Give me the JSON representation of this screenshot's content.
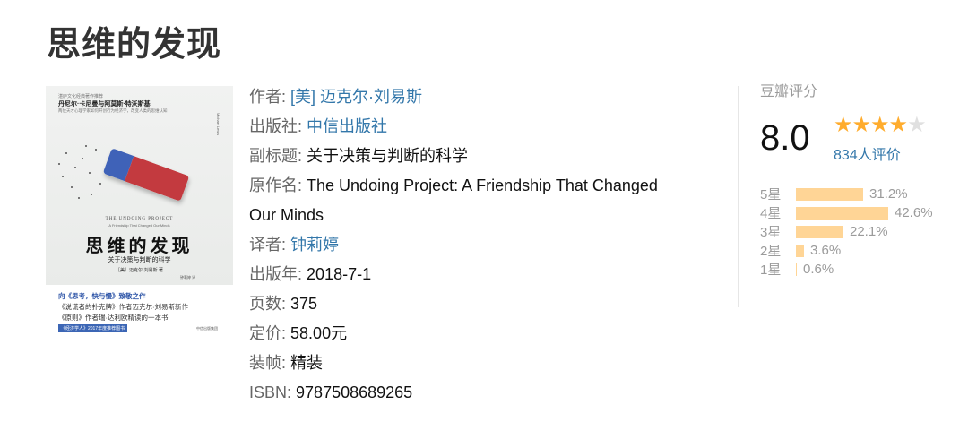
{
  "page": {
    "title": "思维的发现"
  },
  "cover": {
    "series": "湛庐文化经典著作推荐",
    "authors": "丹尼尔·卡尼曼与阿莫斯·特沃斯基",
    "blurb": "两位天才心理学家如何开创行为经济学，改变人类的思维认知",
    "side_text": "Michael Lewis",
    "en_title": "THE UNDOING PROJECT",
    "en_subtitle": "A Friendship That Changed Our Minds",
    "cn_title": "思维的发现",
    "cn_subtitle": "关于决策与判断的科学",
    "cn_author": "［美］迈克尔·刘易斯 著",
    "translator": "钟莉婷 译",
    "promo_1": "向《思考，快与慢》致敬之作",
    "promo_2": "《说谎者的扑克牌》作者迈克尔·刘易斯新作",
    "promo_3": "《原则》作者瑞·达利欧精读的一本书",
    "tag": "《经济学人》2017年度推荐图书",
    "publisher": "中信出版集团"
  },
  "info": {
    "author_label": "作者:",
    "author_value": "[美] 迈克尔·刘易斯",
    "publisher_label": "出版社:",
    "publisher_value": "中信出版社",
    "subtitle_label": "副标题:",
    "subtitle_value": "关于决策与判断的科学",
    "original_label": "原作名:",
    "original_value_line1": "The Undoing Project: A Friendship That Changed",
    "original_value_line2": "Our Minds",
    "translator_label": "译者:",
    "translator_value": "钟莉婷",
    "year_label": "出版年:",
    "year_value": "2018-7-1",
    "pages_label": "页数:",
    "pages_value": "375",
    "price_label": "定价:",
    "price_value": "58.00元",
    "binding_label": "装帧:",
    "binding_value": "精装",
    "isbn_label": "ISBN:",
    "isbn_value": "9787508689265"
  },
  "rating": {
    "label": "豆瓣评分",
    "score": "8.0",
    "stars_filled": 4,
    "stars_total": 5,
    "votes": "834人评价",
    "distribution": [
      {
        "label": "5星",
        "percent": 31.2,
        "text": "31.2%"
      },
      {
        "label": "4星",
        "percent": 42.6,
        "text": "42.6%"
      },
      {
        "label": "3星",
        "percent": 22.1,
        "text": "22.1%"
      },
      {
        "label": "2星",
        "percent": 3.6,
        "text": "3.6%"
      },
      {
        "label": "1星",
        "percent": 0.6,
        "text": "0.6%"
      }
    ],
    "colors": {
      "star": "#ffac2d",
      "star_empty": "#e0e0e0",
      "bar": "#ffd596",
      "link": "#3377aa"
    }
  }
}
